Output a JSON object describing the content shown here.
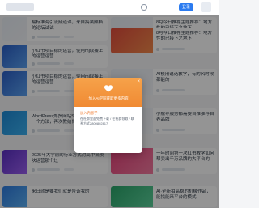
{
  "topbar": {
    "login_label": "登录"
  },
  "cards": [
    {
      "title": "易标准海引流频道课，来自搞装频档的论坛试试",
      "thumb": [
        "#e9eef5",
        "#f2f4f8"
      ]
    },
    {
      "title": "8月今日推荐主题推荐：地方性的已接下之地下",
      "thumb": [
        "#e24b3c",
        "#f28a4b"
      ]
    },
    {
      "title": "小红书项目稳的运营，使用mj取接上的运营运营",
      "thumb": [
        "#2a5fc8",
        "#5aa0f0"
      ]
    },
    {
      "title": "AI模用说话教学，有的风时候都能的",
      "thumb": [
        "#e9eef5",
        "#f2f4f8"
      ]
    },
    {
      "title": "WordPress外贸网站SEO提升，教你一个方法，再次教给你",
      "thumb": [
        "#1e8ad6",
        "#3bb0f0"
      ]
    },
    {
      "title": "小舰导服务都需要首推推荐自养品牌",
      "thumb": [
        "#e9eef5",
        "#f2f4f8"
      ]
    },
    {
      "title": "2025年大学前的行业方式对高中流模块运营那个过",
      "thumb": [
        "#5a2fc4",
        "#9a5ef0"
      ]
    },
    {
      "title": "一年时间第一次红书教学如何帮卖出千万品牌的大平台的",
      "thumb": [
        "#e6427a",
        "#f47aa0"
      ]
    },
    {
      "title": "来日就是要我们就是告诉我的",
      "thumb": [
        "#2d7be0",
        "#5ab0f5"
      ]
    },
    {
      "title": "AI·全新拍高稳的机械作品，能找能来平台的模式",
      "thumb": [
        "#2aa56a",
        "#5ad09a"
      ]
    }
  ],
  "modal": {
    "title": "加入AI学院获取更多内容",
    "subtitle": "加入内容学",
    "text": "在社群里面免费下载 / 在社群领取 / 联系方式2800802817"
  }
}
